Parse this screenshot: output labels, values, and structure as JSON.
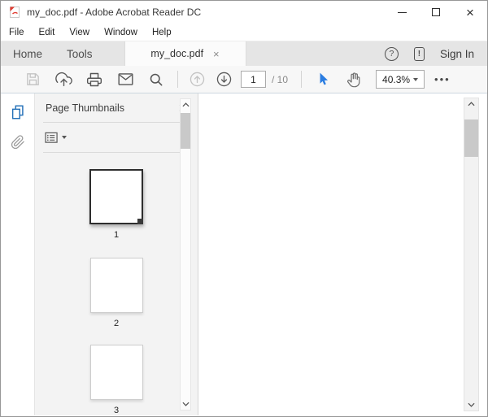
{
  "window": {
    "title": "my_doc.pdf - Adobe Acrobat Reader DC",
    "controls": {
      "close_glyph": "×"
    }
  },
  "menu": {
    "items": [
      "File",
      "Edit",
      "View",
      "Window",
      "Help"
    ]
  },
  "tabbar": {
    "home_label": "Home",
    "tools_label": "Tools",
    "document_tab_label": "my_doc.pdf",
    "tab_close_glyph": "×",
    "help_glyph": "?",
    "device_glyph": "!",
    "sign_in_label": "Sign In"
  },
  "toolbar": {
    "page_current": "1",
    "page_total_label": "/ 10",
    "zoom_value": "40.3%",
    "more_glyph": "•••"
  },
  "panel": {
    "title": "Page Thumbnails",
    "close_glyph": "×",
    "thumbnails": [
      {
        "label": "1",
        "selected": true
      },
      {
        "label": "2",
        "selected": false
      },
      {
        "label": "3",
        "selected": false
      }
    ]
  },
  "icons": {
    "titlebar": "pdf-file-icon",
    "toolbar": [
      "save-icon",
      "upload-cloud-icon",
      "print-icon",
      "email-icon",
      "search-icon",
      "previous-page-icon",
      "next-page-icon",
      "select-tool-icon",
      "hand-tool-icon",
      "zoom-dropdown-caret",
      "more-options-icon"
    ],
    "sidebar": [
      "page-thumbnails-icon",
      "attachments-icon"
    ],
    "panel": [
      "thumbnail-options-icon"
    ]
  },
  "colors": {
    "accent_blue": "#2b7de1",
    "sidebar_active_blue": "#2471b8",
    "pdf_red": "#e03c31",
    "toolbar_border": "#ccd7df",
    "disabled_icon": "#c3c3c3",
    "icon_gray": "#555555"
  }
}
